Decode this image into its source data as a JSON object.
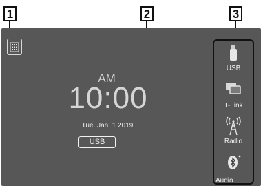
{
  "callouts": [
    "1",
    "2",
    "3"
  ],
  "clock": {
    "ampm": "AM",
    "time": "10:00",
    "date": "Tue. Jan. 1 2019"
  },
  "source_button": {
    "label": "USB"
  },
  "shortcuts": [
    {
      "label": "USB",
      "icon": "usb-drive-icon"
    },
    {
      "label": "T-Link",
      "icon": "screens-icon"
    },
    {
      "label": "Radio",
      "icon": "radio-tower-icon"
    },
    {
      "label": "Audio",
      "icon": "bluetooth-audio-icon"
    }
  ]
}
